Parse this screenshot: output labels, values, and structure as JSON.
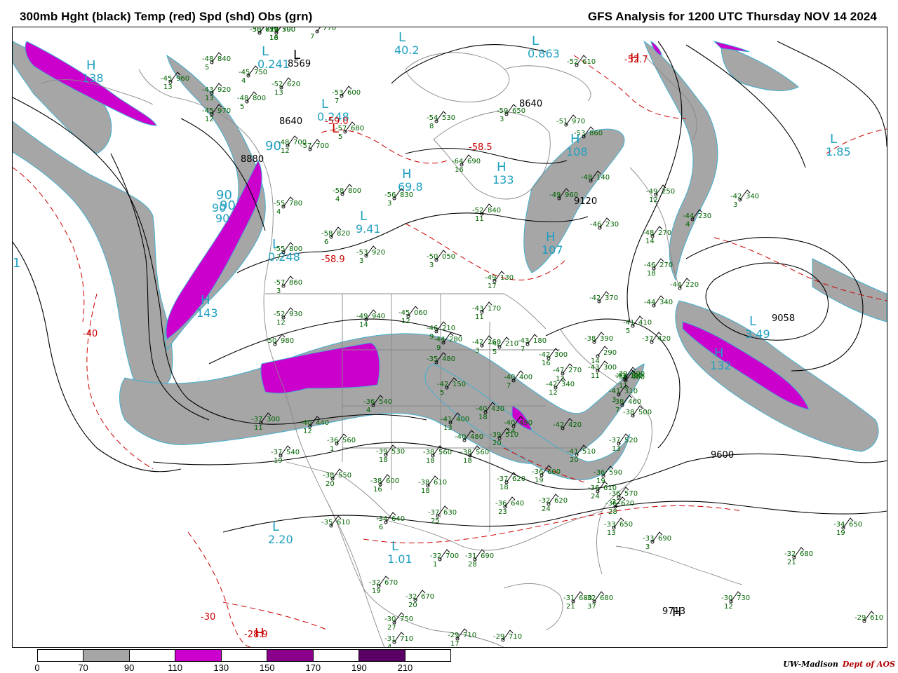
{
  "header": {
    "left_title": "300mb Hght (black) Temp (red) Spd (shd) Obs (grn)",
    "right_title": "GFS Analysis for 1200 UTC Thursday  NOV 14 2024"
  },
  "colors": {
    "height_contour": "#000000",
    "temp_contour": "#cc0000",
    "obs": "#006400",
    "center_label": "#20a0c0",
    "map_outline": "#888888",
    "speed_70_90": "#a6a6a6",
    "speed_110_130": "#cc00cc",
    "jet_edge": "#40b0d0"
  },
  "colorbar": {
    "ticks": [
      "0",
      "70",
      "90",
      "110",
      "130",
      "150",
      "170",
      "190",
      "210"
    ],
    "segments": [
      "#ffffff",
      "#a6a6a6",
      "#ffffff",
      "#cc00cc",
      "#ffffff",
      "#8b008b",
      "#ffffff",
      "#5a0064",
      "#ffffff"
    ]
  },
  "credit": {
    "org": "UW-Madison",
    "dept": "Dept of AOS"
  },
  "height_labels": [
    "8569",
    "8640",
    "8880",
    "8640",
    "9120",
    "9058",
    "9600",
    "9713"
  ],
  "temp_labels": [
    "-59.0",
    "-58.5",
    "-58.9",
    "-40",
    "-30",
    "-28.9",
    "-52.7"
  ],
  "centers": [
    {
      "letter": "H",
      "value": "138",
      "color": "#20a0c0"
    },
    {
      "letter": "L",
      "value": "40.2",
      "color": "#20a0c0"
    },
    {
      "letter": "L",
      "value": "0.863",
      "color": "#20a0c0"
    },
    {
      "letter": "L",
      "value": "0.241",
      "color": "#20a0c0"
    },
    {
      "letter": "L",
      "value": "0.248",
      "color": "#20a0c0"
    },
    {
      "letter": "H",
      "value": "69.8",
      "color": "#20a0c0"
    },
    {
      "letter": "L",
      "value": "9.41",
      "color": "#20a0c0"
    },
    {
      "letter": "L",
      "value": "0.248",
      "color": "#20a0c0"
    },
    {
      "letter": "H",
      "value": "143",
      "color": "#20a0c0"
    },
    {
      "letter": "H",
      "value": "133",
      "color": "#20a0c0"
    },
    {
      "letter": "H",
      "value": "108",
      "color": "#20a0c0"
    },
    {
      "letter": "L",
      "value": "1.85",
      "color": "#20a0c0"
    },
    {
      "letter": "H",
      "value": "107",
      "color": "#20a0c0"
    },
    {
      "letter": "L",
      "value": "3.49",
      "color": "#20a0c0"
    },
    {
      "letter": "H",
      "value": "132",
      "color": "#20a0c0"
    },
    {
      "letter": "L",
      "value": "2.20",
      "color": "#20a0c0"
    },
    {
      "letter": "L",
      "value": "1.01",
      "color": "#20a0c0"
    },
    {
      "letter": "H",
      "value": "",
      "color": "#000000"
    },
    {
      "letter": "H",
      "value": "",
      "color": "#cc0000"
    },
    {
      "letter": "H",
      "value": "",
      "color": "#cc0000"
    },
    {
      "letter": "L",
      "value": "",
      "color": "#cc0000"
    },
    {
      "letter": "L",
      "value": "",
      "color": "#000000"
    },
    {
      "letter": "90",
      "value": "90",
      "color": "#20a0c0"
    },
    {
      "letter": "90",
      "value": "90",
      "color": "#20a0c0"
    },
    {
      "letter": "90",
      "value": "",
      "color": "#20a0c0"
    },
    {
      "letter": "1",
      "value": "",
      "color": "#20a0c0"
    }
  ],
  "obs": [
    {
      "t": "-58",
      "h": "610",
      "s": ""
    },
    {
      "t": "-59",
      "h": "590",
      "s": "18"
    },
    {
      "t": "",
      "h": "770",
      "s": "7"
    },
    {
      "t": "-48",
      "h": "840",
      "s": "5"
    },
    {
      "t": "-45",
      "h": "750",
      "s": "4"
    },
    {
      "t": "-52",
      "h": "620",
      "s": "13"
    },
    {
      "t": "-45",
      "h": "960",
      "s": "13"
    },
    {
      "t": "-43",
      "h": "920",
      "s": "13"
    },
    {
      "t": "-48",
      "h": "800",
      "s": "5"
    },
    {
      "t": "-45",
      "h": "970",
      "s": "12"
    },
    {
      "t": "-53",
      "h": "600",
      "s": "7"
    },
    {
      "t": "-54",
      "h": "530",
      "s": "8"
    },
    {
      "t": "-57",
      "h": "680",
      "s": "5"
    },
    {
      "t": "-59",
      "h": "650",
      "s": "3"
    },
    {
      "t": "-52",
      "h": "610",
      "s": ""
    },
    {
      "t": "-51",
      "h": "970",
      "s": ""
    },
    {
      "t": "-53",
      "h": "860",
      "s": ""
    },
    {
      "t": "-64",
      "h": "690",
      "s": "16"
    },
    {
      "t": "-48",
      "h": "700",
      "s": "12"
    },
    {
      "t": "-57",
      "h": "700",
      "s": ""
    },
    {
      "t": "-48",
      "h": "140",
      "s": ""
    },
    {
      "t": "-49",
      "h": "960",
      "s": ""
    },
    {
      "t": "-49",
      "h": "250",
      "s": "12"
    },
    {
      "t": "-42",
      "h": "340",
      "s": "3"
    },
    {
      "t": "-58",
      "h": "800",
      "s": "4"
    },
    {
      "t": "-56",
      "h": "830",
      "s": "3"
    },
    {
      "t": "-52",
      "h": "840",
      "s": "11"
    },
    {
      "t": "-55",
      "h": "780",
      "s": "4"
    },
    {
      "t": "-44",
      "h": "230",
      "s": "4"
    },
    {
      "t": "-46",
      "h": "230",
      "s": ""
    },
    {
      "t": "-48",
      "h": "270",
      "s": "14"
    },
    {
      "t": "-58",
      "h": "820",
      "s": "6"
    },
    {
      "t": "-55",
      "h": "800",
      "s": "7"
    },
    {
      "t": "-53",
      "h": "920",
      "s": "3"
    },
    {
      "t": "-50",
      "h": "050",
      "s": "3"
    },
    {
      "t": "-46",
      "h": "270",
      "s": "18"
    },
    {
      "t": "-57",
      "h": "860",
      "s": "3"
    },
    {
      "t": "-49",
      "h": "130",
      "s": "17"
    },
    {
      "t": "-44",
      "h": "220",
      "s": ""
    },
    {
      "t": "-42",
      "h": "370",
      "s": ""
    },
    {
      "t": "-44",
      "h": "340",
      "s": ""
    },
    {
      "t": "-52",
      "h": "930",
      "s": "12"
    },
    {
      "t": "-49",
      "h": "940",
      "s": "14"
    },
    {
      "t": "-45",
      "h": "060",
      "s": "12"
    },
    {
      "t": "-43",
      "h": "170",
      "s": "11"
    },
    {
      "t": "-41",
      "h": "410",
      "s": "5"
    },
    {
      "t": "-50",
      "h": "980",
      "s": ""
    },
    {
      "t": "-46",
      "h": "210",
      "s": "9"
    },
    {
      "t": "-42",
      "h": "260",
      "s": "3"
    },
    {
      "t": "-43",
      "h": "180",
      "s": "7"
    },
    {
      "t": "-38",
      "h": "390",
      "s": ""
    },
    {
      "t": "-37",
      "h": "420",
      "s": ""
    },
    {
      "t": "-44",
      "h": "280",
      "s": "9"
    },
    {
      "t": "-42",
      "h": "210",
      "s": "5"
    },
    {
      "t": "-42",
      "h": "300",
      "s": "16"
    },
    {
      "t": "-47",
      "h": "270",
      "s": "12"
    },
    {
      "t": "",
      "h": "290",
      "s": "14"
    },
    {
      "t": "-39",
      "h": "400",
      "s": ""
    },
    {
      "t": "-36",
      "h": "460",
      "s": "11"
    },
    {
      "t": "-35",
      "h": "480",
      "s": ""
    },
    {
      "t": "-43",
      "h": "300",
      "s": "11"
    },
    {
      "t": "-43",
      "h": "180",
      "s": ""
    },
    {
      "t": "-42",
      "h": "150",
      "s": "5"
    },
    {
      "t": "-40",
      "h": "400",
      "s": "7"
    },
    {
      "t": "-42",
      "h": "340",
      "s": "12"
    },
    {
      "t": "-41",
      "h": "310",
      "s": "3"
    },
    {
      "t": "-38",
      "h": "460",
      "s": "7"
    },
    {
      "t": "-38",
      "h": "500",
      "s": ""
    },
    {
      "t": "-36",
      "h": "540",
      "s": "4"
    },
    {
      "t": "-40",
      "h": "430",
      "s": "18"
    },
    {
      "t": "-41",
      "h": "400",
      "s": "13"
    },
    {
      "t": "-40",
      "h": "490",
      "s": "14"
    },
    {
      "t": "-42",
      "h": "420",
      "s": ""
    },
    {
      "t": "-37",
      "h": "300",
      "s": "11"
    },
    {
      "t": "-40",
      "h": "440",
      "s": "12"
    },
    {
      "t": "-40",
      "h": "480",
      "s": ""
    },
    {
      "t": "-39",
      "h": "510",
      "s": "20"
    },
    {
      "t": "-41",
      "h": "510",
      "s": "20"
    },
    {
      "t": "-37",
      "h": "520",
      "s": "13"
    },
    {
      "t": "-36",
      "h": "560",
      "s": "1"
    },
    {
      "t": "-39",
      "h": "530",
      "s": "18"
    },
    {
      "t": "-38",
      "h": "560",
      "s": "18"
    },
    {
      "t": "-38",
      "h": "560",
      "s": "18"
    },
    {
      "t": "-37",
      "h": "540",
      "s": "19"
    },
    {
      "t": "-38",
      "h": "550",
      "s": "20"
    },
    {
      "t": "-38",
      "h": "600",
      "s": "16"
    },
    {
      "t": "-38",
      "h": "610",
      "s": "18"
    },
    {
      "t": "-37",
      "h": "620",
      "s": "18"
    },
    {
      "t": "-36",
      "h": "600",
      "s": "19"
    },
    {
      "t": "-36",
      "h": "590",
      "s": "19"
    },
    {
      "t": "-36",
      "h": "570",
      "s": "22"
    },
    {
      "t": "-35",
      "h": "610",
      "s": ""
    },
    {
      "t": "-34",
      "h": "640",
      "s": "6"
    },
    {
      "t": "-37",
      "h": "630",
      "s": "25"
    },
    {
      "t": "-36",
      "h": "610",
      "s": "24"
    },
    {
      "t": "-36",
      "h": "640",
      "s": "23"
    },
    {
      "t": "-32",
      "h": "620",
      "s": "24"
    },
    {
      "t": "-36",
      "h": "620",
      "s": "28"
    },
    {
      "t": "-33",
      "h": "650",
      "s": "13"
    },
    {
      "t": "-33",
      "h": "690",
      "s": "3"
    },
    {
      "t": "-34",
      "h": "650",
      "s": "19"
    },
    {
      "t": "-32",
      "h": "700",
      "s": "1"
    },
    {
      "t": "-31",
      "h": "690",
      "s": "28"
    },
    {
      "t": "-32",
      "h": "670",
      "s": "19"
    },
    {
      "t": "-32",
      "h": "670",
      "s": "20"
    },
    {
      "t": "-32",
      "h": "680",
      "s": "21"
    },
    {
      "t": "-31",
      "h": "680",
      "s": "21"
    },
    {
      "t": "-32",
      "h": "680",
      "s": "37"
    },
    {
      "t": "-30",
      "h": "730",
      "s": "12"
    },
    {
      "t": "-30",
      "h": "750",
      "s": "27"
    },
    {
      "t": "-31",
      "h": "710",
      "s": "4"
    },
    {
      "t": "-29",
      "h": "710",
      "s": "17"
    },
    {
      "t": "-29",
      "h": "710",
      "s": ""
    },
    {
      "t": "-29",
      "h": "610",
      "s": ""
    },
    {
      "t": "-30",
      "h": "720",
      "s": ""
    },
    {
      "t": "-31",
      "h": "700",
      "s": "16"
    }
  ]
}
